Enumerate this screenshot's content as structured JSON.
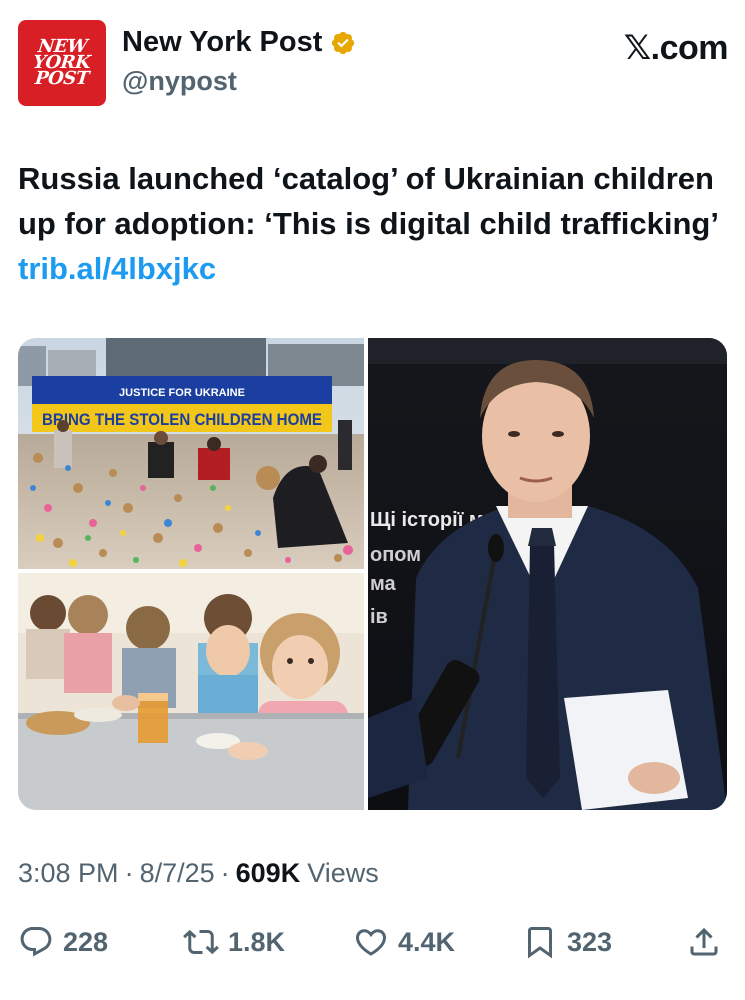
{
  "account": {
    "avatar_lines": [
      "NEW",
      "YORK",
      "POST"
    ],
    "display_name": "New York Post",
    "handle": "@nypost",
    "verified_icon": "gold-verified-badge-icon",
    "verified_color": "#e8a700"
  },
  "source": {
    "label": ".com",
    "logo_icon": "x-logo-icon"
  },
  "tweet": {
    "text": "Russia launched ‘catalog’ of Ukrainian children up for adoption: ‘This is digital child trafficking’",
    "link": "trib.al/4lbxjkc",
    "link_color": "#1d9bf0"
  },
  "media": {
    "banner_top": "JUSTICE FOR UKRAINE",
    "banner_main": "BRING THE STOLEN CHILDREN HOME",
    "screen_text": [
      "Щі історії м",
      "опом",
      "ма",
      "ів"
    ]
  },
  "meta": {
    "time": "3:08 PM",
    "sep1": "·",
    "date": "8/7/25",
    "sep2": "·",
    "views_count": "609K",
    "views_label": "Views"
  },
  "actions": {
    "replies": "228",
    "reposts": "1.8K",
    "likes": "4.4K",
    "bookmarks": "323"
  },
  "colors": {
    "text_primary": "#0f1419",
    "text_secondary": "#536471",
    "brand_red": "#d81f26"
  }
}
